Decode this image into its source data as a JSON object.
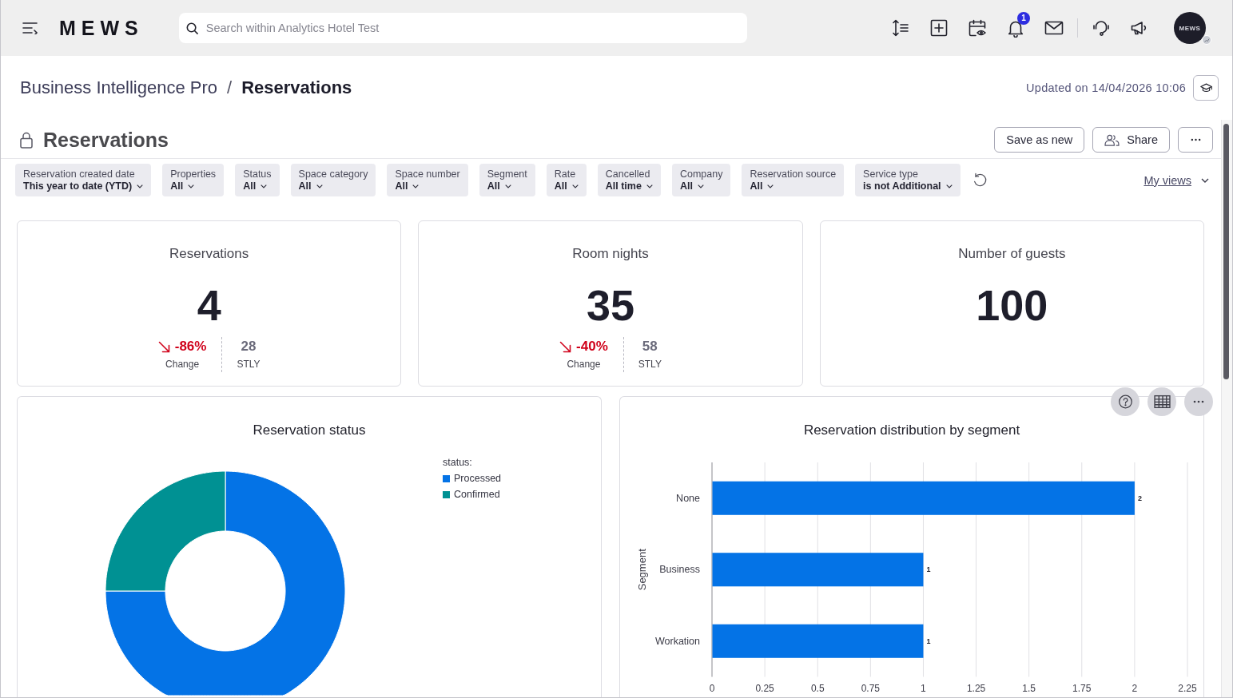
{
  "top_bar": {
    "logo": "MEWS",
    "search": {
      "placeholder": "Search within Analytics Hotel Test"
    },
    "notification_count": "1",
    "account": {
      "avatar_text": "MEWS"
    }
  },
  "breadcrumb": {
    "items": [
      {
        "label": "Business Intelligence Pro",
        "current": false
      },
      {
        "label": "Reservations",
        "current": true
      }
    ],
    "separator": "/"
  },
  "updated": "Updated on 14/04/2026 10:06",
  "report": {
    "title": "Reservations",
    "locked": true,
    "actions": {
      "save_as_new": "Save as new",
      "share": "Share"
    }
  },
  "filters": [
    {
      "label": "Reservation created date",
      "value": "This year to date (YTD)"
    },
    {
      "label": "Properties",
      "value": "All"
    },
    {
      "label": "Status",
      "value": "All"
    },
    {
      "label": "Space category",
      "value": "All"
    },
    {
      "label": "Space number",
      "value": "All"
    },
    {
      "label": "Segment",
      "value": "All"
    },
    {
      "label": "Rate",
      "value": "All"
    },
    {
      "label": "Cancelled",
      "value": "All time"
    },
    {
      "label": "Company",
      "value": "All"
    },
    {
      "label": "Reservation source",
      "value": "All"
    },
    {
      "label": "Service type",
      "value": "is not Additional"
    }
  ],
  "my_views": "My views",
  "kpis": [
    {
      "title": "Reservations",
      "value": "4",
      "change": {
        "value": "-86%",
        "label": "Change",
        "decrease": true
      },
      "comparison": {
        "value": "28",
        "label": "STLY"
      }
    },
    {
      "title": "Room nights",
      "value": "35",
      "change": {
        "value": "-40%",
        "label": "Change",
        "decrease": true
      },
      "comparison": {
        "value": "58",
        "label": "STLY"
      }
    },
    {
      "title": "Number of guests",
      "value": "100"
    }
  ],
  "charts": [
    {
      "legend_title": "status:",
      "chart_data": {
        "type": "donut",
        "title": "Reservation status",
        "categories": [
          "Processed",
          "Confirmed"
        ],
        "values": [
          75,
          25
        ],
        "colors": [
          "#0473e6",
          "#009193"
        ]
      }
    },
    {
      "chart_data": {
        "type": "bar",
        "orientation": "horizontal",
        "title": "Reservation distribution by segment",
        "ylabel": "Segment",
        "categories": [
          "None",
          "Business",
          "Workation"
        ],
        "series": [
          {
            "color": "#0473e6",
            "values": [
              2,
              1,
              1
            ]
          }
        ],
        "xlim": [
          0,
          2.25
        ],
        "xticks": [
          0,
          0.25,
          0.5,
          0.75,
          1,
          1.25,
          1.5,
          1.75,
          2,
          2.25
        ],
        "grid": true,
        "data_labels": true
      }
    }
  ]
}
